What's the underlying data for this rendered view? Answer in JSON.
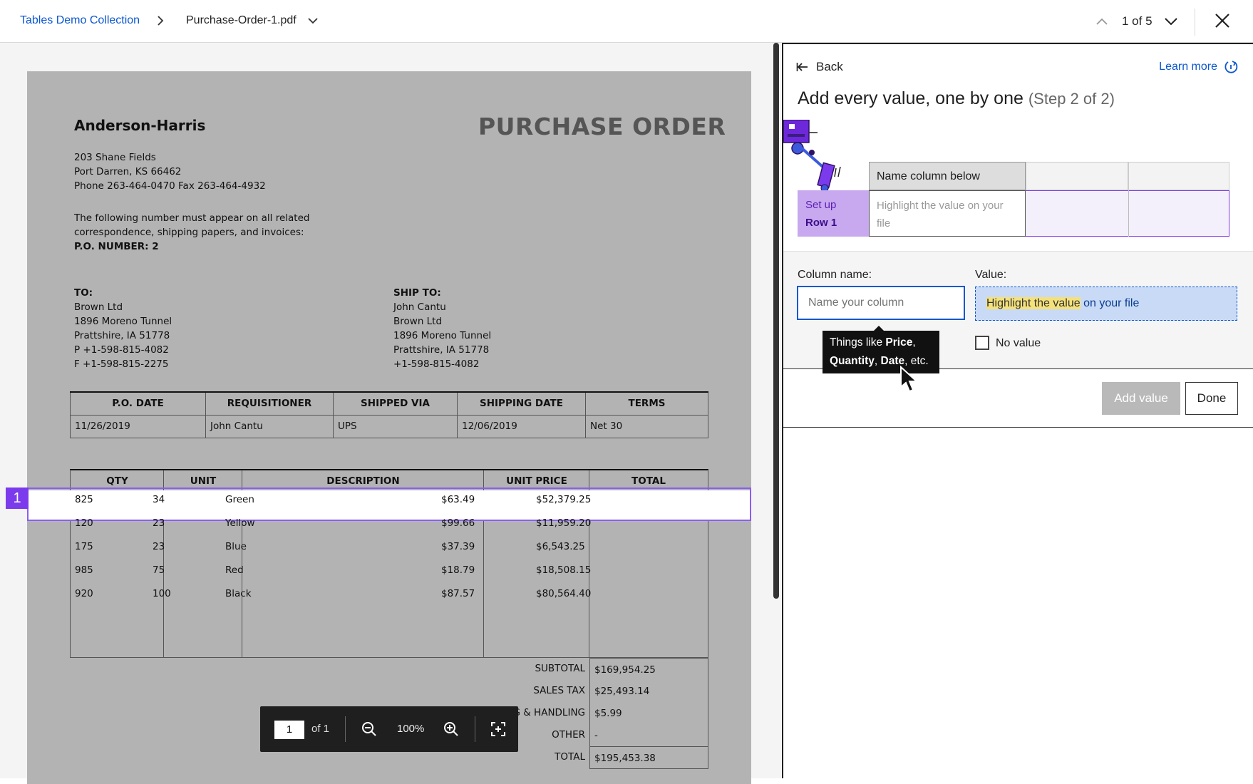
{
  "topbar": {
    "breadcrumb_link": "Tables Demo Collection",
    "file_name": "Purchase-Order-1.pdf",
    "pager_text": "1 of 5"
  },
  "document": {
    "company": "Anderson-Harris",
    "title": "PURCHASE ORDER",
    "address": [
      "203 Shane Fields",
      "Port Darren, KS 66462",
      "Phone 263-464-0470  Fax 263-464-4932"
    ],
    "note_lines": [
      "The following number must appear on all related",
      "correspondence, shipping papers, and invoices:"
    ],
    "po_number": "P.O. NUMBER: 2",
    "to_label": "TO:",
    "to_lines": [
      "Brown Ltd",
      "1896 Moreno Tunnel",
      "Prattshire, IA 51778",
      "P +1-598-815-4082",
      "F +1-598-815-2275"
    ],
    "shipto_label": "SHIP TO:",
    "shipto_lines": [
      "John Cantu",
      "Brown Ltd",
      "1896 Moreno Tunnel",
      "Prattshire, IA 51778",
      "+1-598-815-4082"
    ],
    "order_table": {
      "headers": [
        "P.O. DATE",
        "REQUISITIONER",
        "SHIPPED VIA",
        "SHIPPING DATE",
        "TERMS"
      ],
      "row": [
        "11/26/2019",
        "John Cantu",
        "UPS",
        "12/06/2019",
        "Net 30"
      ]
    },
    "items_table": {
      "headers": [
        "QTY",
        "UNIT",
        "DESCRIPTION",
        "UNIT PRICE",
        "TOTAL"
      ],
      "rows": [
        [
          "825",
          "34",
          "Green",
          "$63.49",
          "$52,379.25"
        ],
        [
          "120",
          "23",
          "Yellow",
          "$99.66",
          "$11,959.20"
        ],
        [
          "175",
          "23",
          "Blue",
          "$37.39",
          "$6,543.25"
        ],
        [
          "985",
          "75",
          "Red",
          "$18.79",
          "$18,508.15"
        ],
        [
          "920",
          "100",
          "Black",
          "$87.57",
          "$80,564.40"
        ]
      ]
    },
    "totals": [
      {
        "label": "SUBTOTAL",
        "value": "$169,954.25"
      },
      {
        "label": "SALES TAX",
        "value": "$25,493.14"
      },
      {
        "label": "G & HANDLING",
        "value": "$5.99"
      },
      {
        "label": "OTHER",
        "value": "-"
      },
      {
        "label": "TOTAL",
        "value": "$195,453.38"
      }
    ],
    "row_badge": "1"
  },
  "zoombar": {
    "page_input": "1",
    "of_pages": "of 1",
    "zoom": "100%"
  },
  "panel": {
    "back_label": "Back",
    "learn_more": "Learn more",
    "heading": "Add every value, one by one",
    "step": "(Step 2 of 2)",
    "demo": {
      "header_name": "Name column below",
      "setup_line1": "Set up",
      "setup_line2": "Row 1",
      "hint": "Highlight the value on your file"
    },
    "column_name_label": "Column name:",
    "column_placeholder": "Name your column",
    "value_label": "Value:",
    "value_highlight": "Highlight the value",
    "value_rest": " on your file",
    "tooltip_prefix": "Things like ",
    "tooltip_price": "Price",
    "tooltip_quantity": "Quantity",
    "tooltip_date": "Date",
    "tooltip_suffix": ", etc.",
    "no_value_label": "No value",
    "add_value_button": "Add value",
    "done_button": "Done"
  }
}
